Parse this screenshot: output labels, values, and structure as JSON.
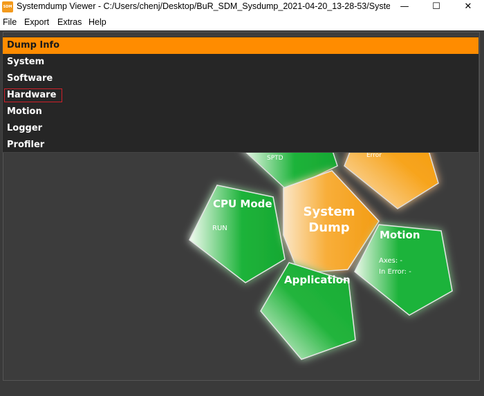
{
  "window": {
    "title": "Systemdump Viewer - C:/Users/chenj/Desktop/BuR_SDM_Sysdump_2021-04-20_13-28-53/Systemdu...",
    "icon_label": "SDM",
    "controls": {
      "minimize": "—",
      "maximize": "☐",
      "close": "✕"
    }
  },
  "menu": {
    "file": "File",
    "export": "Export",
    "extras": "Extras",
    "help": "Help"
  },
  "dropdown": {
    "header": "Dump Info",
    "items": [
      "System",
      "Software",
      "Hardware",
      "Motion",
      "Logger",
      "Profiler"
    ],
    "highlighted": "Hardware",
    "highlight_color": "#d0202a"
  },
  "petals": {
    "top_left_sub": "SPTD",
    "top_right_sub": "Error",
    "cpu_mode": {
      "title": "CPU Mode",
      "value": "RUN"
    },
    "center": {
      "line1": "System",
      "line2": "Dump"
    },
    "motion": {
      "title": "Motion",
      "axes": "Axes: -",
      "in_error": "In Error: -"
    },
    "application": {
      "title": "Application"
    }
  },
  "colors": {
    "accent_orange": "#ff8c00",
    "petal_green": "#1db33a",
    "petal_orange": "#f7a417",
    "background": "#3a3a3a"
  }
}
